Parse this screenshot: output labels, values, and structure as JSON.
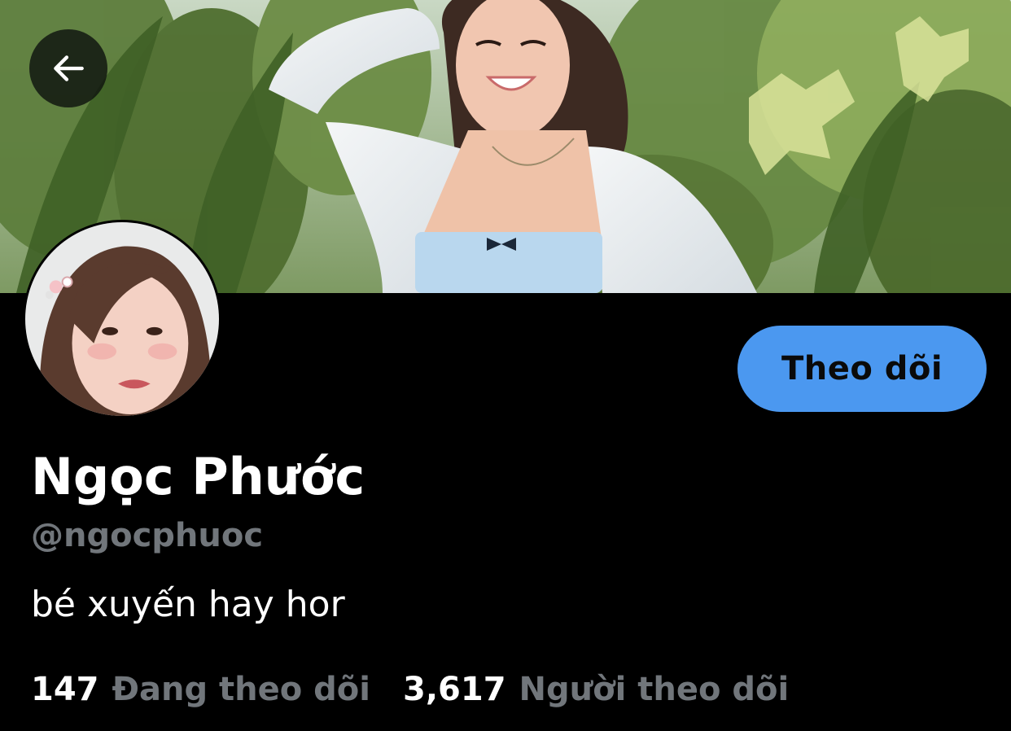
{
  "header": {
    "back_icon": "arrow-left-icon",
    "banner_image": "profile-banner-photo"
  },
  "profile": {
    "avatar_image": "profile-avatar-photo",
    "follow_label": "Theo dõi",
    "display_name": "Ngọc Phước",
    "handle": "@ngocphuoc",
    "bio": "bé xuyến hay hor"
  },
  "stats": {
    "following_count": "147",
    "following_label": "Đang theo dõi",
    "followers_count": "3,617",
    "followers_label": "Người theo dõi"
  },
  "colors": {
    "background": "#000000",
    "accent": "#4b98f0",
    "muted_text": "#71767b",
    "primary_text": "#ffffff"
  }
}
